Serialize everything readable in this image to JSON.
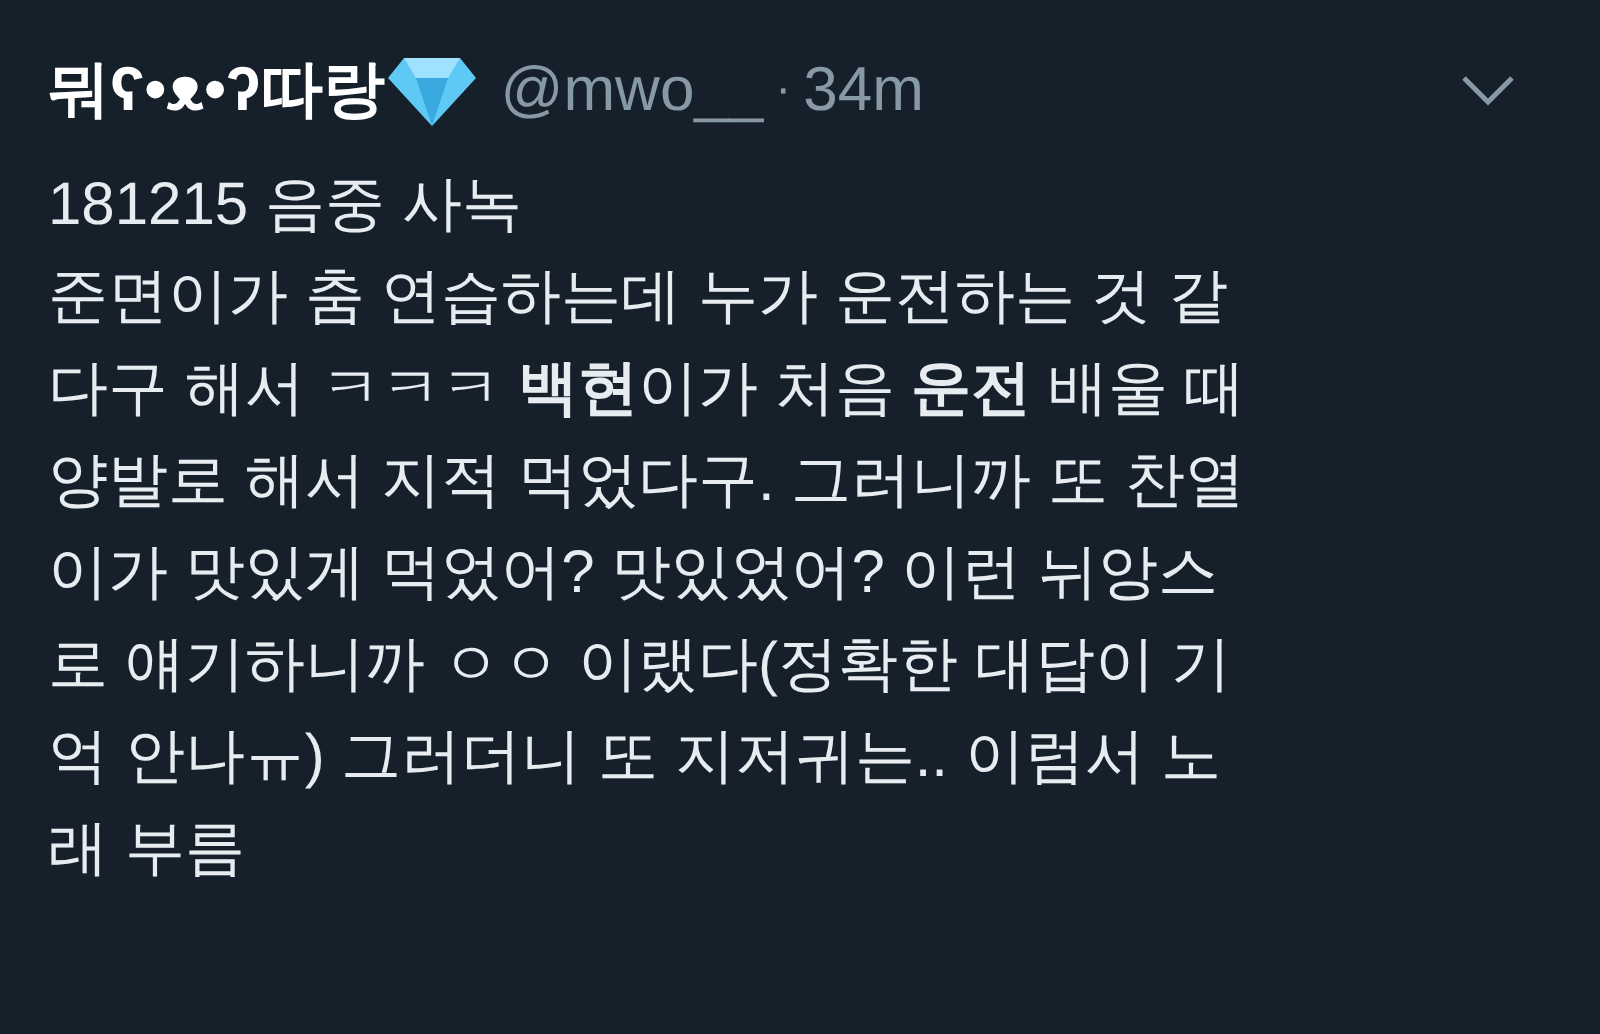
{
  "tweet": {
    "display_name": "뭐ʕ•ᴥ•ʔ따랑",
    "handle": "@mwo__",
    "separator": "·",
    "time": "34m",
    "body": "181215 음중 사녹\n준면이가 춤 연습하는데 누가 운전하는 것 같\n다구 해서 ㅋㅋㅋ **백현**이가 처음 **운전** 배울 때\n양발로 해서 지적 먹었다구. 그러니까 또 찬열\n이가 맛있게 먹었어? 맛있었어? 이런 뉘앙스\n로 얘기하니까 ㅇㅇ 이랬다(정확한 대답이 기\n억 안나ㅠ) 그러더니 또 지저귀는.. 이럼서 노\n래 부름"
  }
}
